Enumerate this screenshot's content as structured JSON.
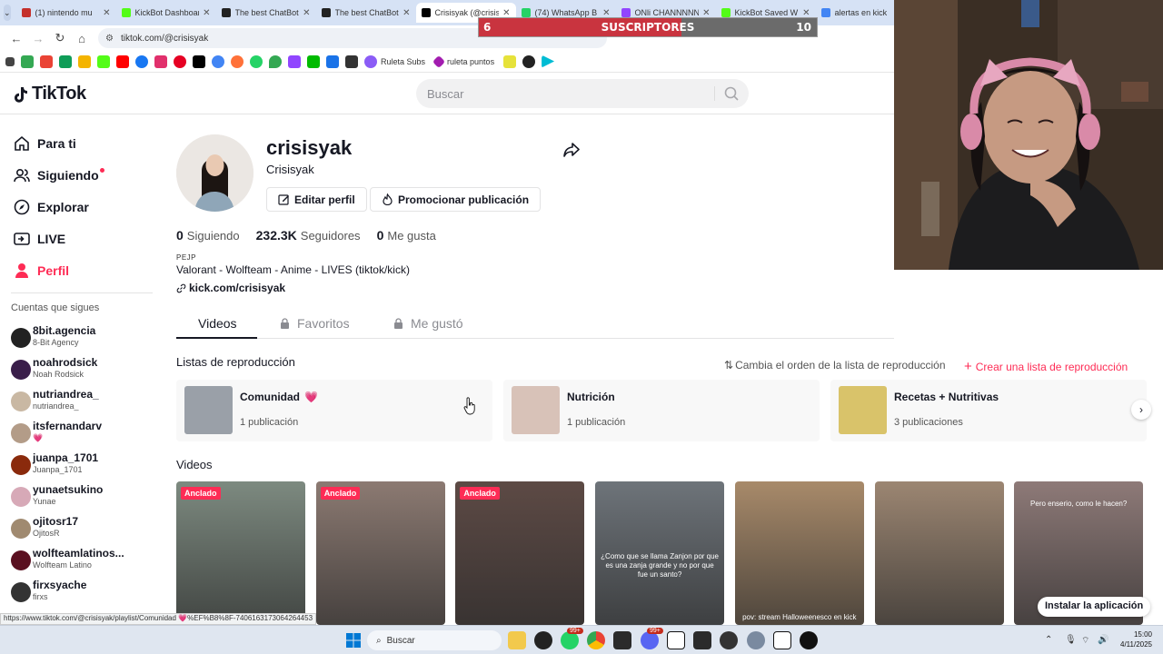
{
  "browser": {
    "tabs": [
      {
        "label": "(1) nintendo mu",
        "color": "#c4302b"
      },
      {
        "label": "KickBot Dashboard",
        "color": "#53fc18"
      },
      {
        "label": "The best ChatBot",
        "color": "#222222"
      },
      {
        "label": "The best ChatBot",
        "color": "#222222"
      },
      {
        "label": "Crisisyak (@crisis",
        "color": "#000000"
      },
      {
        "label": "(74) WhatsApp B",
        "color": "#25d366"
      },
      {
        "label": "ONli CHANNNNN",
        "color": "#9146ff"
      },
      {
        "label": "KickBot Saved W",
        "color": "#53fc18"
      },
      {
        "label": "alertas en kick",
        "color": "#4285f4"
      }
    ],
    "url": "tiktok.com/@crisisyak",
    "bookmarks": {
      "ruleta_subs": "Ruleta Subs",
      "ruleta_puntos": "ruleta puntos"
    },
    "status_url": "https://www.tiktok.com/@crisisyak/playlist/Comunidad 💗%EF%B8%8F-7406163173064264453"
  },
  "overlay": {
    "label": "SUSCRIPTORES",
    "current": "6",
    "goal": "10",
    "progress": 0.6,
    "fill_color": "#c9343f"
  },
  "tiktok": {
    "logo": "TikTok",
    "search_placeholder": "Buscar",
    "nav": [
      {
        "label": "Para ti",
        "icon": "home-icon"
      },
      {
        "label": "Siguiendo",
        "icon": "following-icon"
      },
      {
        "label": "Explorar",
        "icon": "explore-icon"
      },
      {
        "label": "LIVE",
        "icon": "live-icon"
      },
      {
        "label": "Perfil",
        "icon": "profile-icon"
      }
    ],
    "following_title": "Cuentas que sigues",
    "following": [
      {
        "name": "8bit.agencia",
        "sub": "8-Bit Agency",
        "color": "#222"
      },
      {
        "name": "noahrodsick",
        "sub": "Noah Rodsick",
        "color": "#3a1e4a"
      },
      {
        "name": "nutriandrea_",
        "sub": "nutriandrea_",
        "color": "#c9b8a3"
      },
      {
        "name": "itsfernandarv",
        "sub": "💗",
        "color": "#b39c88"
      },
      {
        "name": "juanpa_1701",
        "sub": "Juanpa_1701",
        "color": "#8a2a0c"
      },
      {
        "name": "yunaetsukino",
        "sub": "Yunae",
        "color": "#d7a9b7"
      },
      {
        "name": "ojitosr17",
        "sub": "OjitosR",
        "color": "#a08a70"
      },
      {
        "name": "wolfteamlatinos...",
        "sub": "Wolfteam Latino",
        "color": "#5a1020"
      },
      {
        "name": "firxsyache",
        "sub": "firxs",
        "color": "#333"
      }
    ],
    "profile": {
      "username": "crisisyak",
      "nickname": "Crisisyak",
      "edit_label": "Editar perfil",
      "promote_label": "Promocionar publicación",
      "following_count": "0",
      "following_label": "Siguiendo",
      "followers_count": "232.3K",
      "followers_label": "Seguidores",
      "likes_count": "0",
      "likes_label": "Me gusta",
      "bio_top": "PEJP",
      "bio": "Valorant - Wolfteam - Anime - LIVES (tiktok/kick)",
      "link": "kick.com/crisisyak"
    },
    "tabs": {
      "videos": "Videos",
      "favorites": "Favoritos",
      "liked": "Me gustó"
    },
    "playlists": {
      "title": "Listas de reproducción",
      "reorder": "Cambia el orden de la lista de reproducción",
      "create": "Crear una lista de reproducción",
      "items": [
        {
          "name": "Comunidad",
          "count": "1 publicación",
          "color": "#9aa0a8",
          "heart": "💗"
        },
        {
          "name": "Nutrición",
          "count": "1 publicación",
          "color": "#d8c2b8",
          "heart": ""
        },
        {
          "name": "Recetas + Nutritivas",
          "count": "3 publicaciones",
          "color": "#d9c36a",
          "heart": ""
        }
      ]
    },
    "videos_title": "Videos",
    "pinned_label": "Anclado",
    "videos": [
      {
        "pinned": true,
        "color": "#7d8a80",
        "caption": ""
      },
      {
        "pinned": true,
        "color": "#8c7a72",
        "caption": ""
      },
      {
        "pinned": true,
        "color": "#5d4a45",
        "caption": ""
      },
      {
        "pinned": false,
        "color": "#6e747a",
        "caption": "¿Como que se llama Zanjon por que es una zanja grande y no por que fue un santo?"
      },
      {
        "pinned": false,
        "color": "#a88a6a",
        "caption": "pov: stream Halloweenesco en kick"
      },
      {
        "pinned": false,
        "color": "#9c8672",
        "caption": ""
      },
      {
        "pinned": false,
        "color": "#8e7a78",
        "caption": "Pero enserio, como le hacen?"
      }
    ],
    "install_label": "Instalar la aplicación"
  },
  "taskbar": {
    "search_label": "Buscar",
    "badge_1": "99+",
    "badge_2": "99+",
    "time": "15:00",
    "date": "4/11/2025"
  }
}
